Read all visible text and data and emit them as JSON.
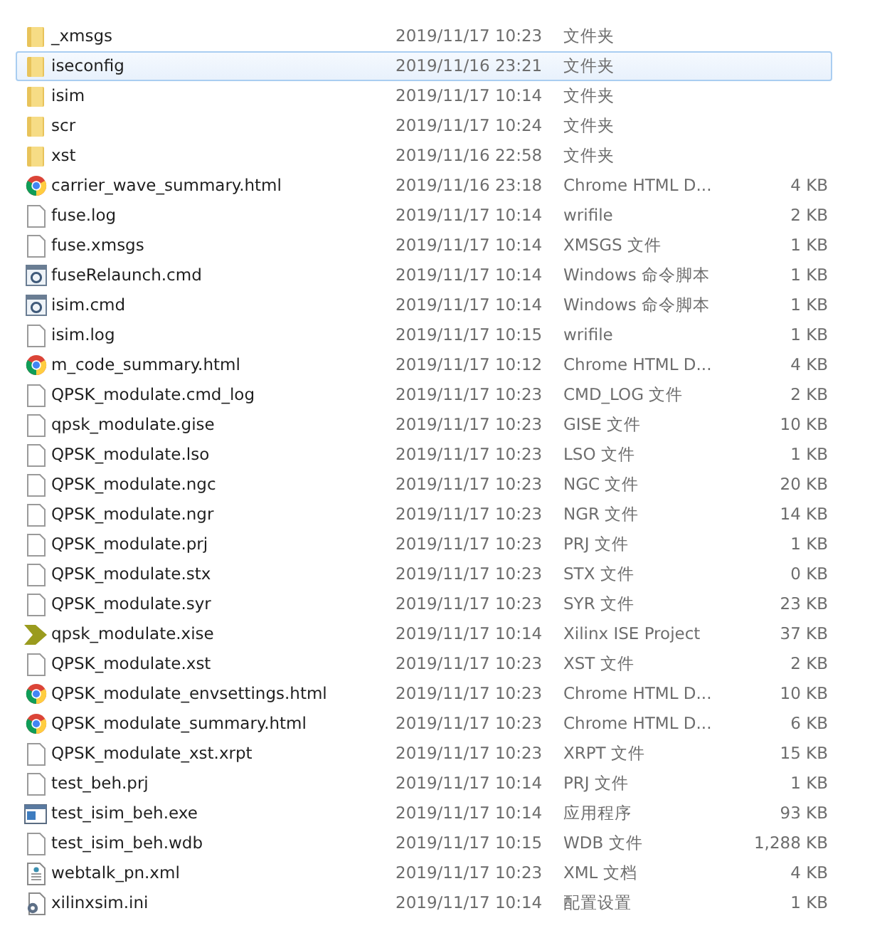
{
  "files": [
    {
      "kind": "folder",
      "name": "_xmsgs",
      "modified": "2019/11/17 10:23",
      "type": "文件夹",
      "selected": false
    },
    {
      "kind": "folder",
      "name": "iseconfig",
      "modified": "2019/11/16 23:21",
      "type": "文件夹",
      "selected": true
    },
    {
      "kind": "folder",
      "name": "isim",
      "modified": "2019/11/17 10:14",
      "type": "文件夹",
      "selected": false
    },
    {
      "kind": "folder",
      "name": "scr",
      "modified": "2019/11/17 10:24",
      "type": "文件夹",
      "selected": false
    },
    {
      "kind": "folder",
      "name": "xst",
      "modified": "2019/11/16 22:58",
      "type": "文件夹",
      "selected": false
    },
    {
      "kind": "chrome",
      "name": "carrier_wave_summary.html",
      "modified": "2019/11/16 23:18",
      "type": "Chrome HTML D...",
      "size": "4 KB",
      "selected": false
    },
    {
      "kind": "file",
      "name": "fuse.log",
      "modified": "2019/11/17 10:14",
      "type": "wrifile",
      "size": "2 KB",
      "selected": false
    },
    {
      "kind": "file",
      "name": "fuse.xmsgs",
      "modified": "2019/11/17 10:14",
      "type": "XMSGS 文件",
      "size": "1 KB",
      "selected": false
    },
    {
      "kind": "cmd",
      "name": "fuseRelaunch.cmd",
      "modified": "2019/11/17 10:14",
      "type": "Windows 命令脚本",
      "size": "1 KB",
      "selected": false
    },
    {
      "kind": "cmd",
      "name": "isim.cmd",
      "modified": "2019/11/17 10:14",
      "type": "Windows 命令脚本",
      "size": "1 KB",
      "selected": false
    },
    {
      "kind": "file",
      "name": "isim.log",
      "modified": "2019/11/17 10:15",
      "type": "wrifile",
      "size": "1 KB",
      "selected": false
    },
    {
      "kind": "chrome",
      "name": "m_code_summary.html",
      "modified": "2019/11/17 10:12",
      "type": "Chrome HTML D...",
      "size": "4 KB",
      "selected": false
    },
    {
      "kind": "file",
      "name": "QPSK_modulate.cmd_log",
      "modified": "2019/11/17 10:23",
      "type": "CMD_LOG 文件",
      "size": "2 KB",
      "selected": false
    },
    {
      "kind": "file",
      "name": "qpsk_modulate.gise",
      "modified": "2019/11/17 10:23",
      "type": "GISE 文件",
      "size": "10 KB",
      "selected": false
    },
    {
      "kind": "file",
      "name": "QPSK_modulate.lso",
      "modified": "2019/11/17 10:23",
      "type": "LSO 文件",
      "size": "1 KB",
      "selected": false
    },
    {
      "kind": "file",
      "name": "QPSK_modulate.ngc",
      "modified": "2019/11/17 10:23",
      "type": "NGC 文件",
      "size": "20 KB",
      "selected": false
    },
    {
      "kind": "file",
      "name": "QPSK_modulate.ngr",
      "modified": "2019/11/17 10:23",
      "type": "NGR 文件",
      "size": "14 KB",
      "selected": false
    },
    {
      "kind": "file",
      "name": "QPSK_modulate.prj",
      "modified": "2019/11/17 10:23",
      "type": "PRJ 文件",
      "size": "1 KB",
      "selected": false
    },
    {
      "kind": "file",
      "name": "QPSK_modulate.stx",
      "modified": "2019/11/17 10:23",
      "type": "STX 文件",
      "size": "0 KB",
      "selected": false
    },
    {
      "kind": "file",
      "name": "QPSK_modulate.syr",
      "modified": "2019/11/17 10:23",
      "type": "SYR 文件",
      "size": "23 KB",
      "selected": false
    },
    {
      "kind": "xise",
      "name": "qpsk_modulate.xise",
      "modified": "2019/11/17 10:14",
      "type": "Xilinx ISE Project",
      "size": "37 KB",
      "selected": false
    },
    {
      "kind": "file",
      "name": "QPSK_modulate.xst",
      "modified": "2019/11/17 10:23",
      "type": "XST 文件",
      "size": "2 KB",
      "selected": false
    },
    {
      "kind": "chrome",
      "name": "QPSK_modulate_envsettings.html",
      "modified": "2019/11/17 10:23",
      "type": "Chrome HTML D...",
      "size": "10 KB",
      "selected": false
    },
    {
      "kind": "chrome",
      "name": "QPSK_modulate_summary.html",
      "modified": "2019/11/17 10:23",
      "type": "Chrome HTML D...",
      "size": "6 KB",
      "selected": false
    },
    {
      "kind": "file",
      "name": "QPSK_modulate_xst.xrpt",
      "modified": "2019/11/17 10:23",
      "type": "XRPT 文件",
      "size": "15 KB",
      "selected": false
    },
    {
      "kind": "file",
      "name": "test_beh.prj",
      "modified": "2019/11/17 10:14",
      "type": "PRJ 文件",
      "size": "1 KB",
      "selected": false
    },
    {
      "kind": "exe",
      "name": "test_isim_beh.exe",
      "modified": "2019/11/17 10:14",
      "type": "应用程序",
      "size": "93 KB",
      "selected": false
    },
    {
      "kind": "file",
      "name": "test_isim_beh.wdb",
      "modified": "2019/11/17 10:15",
      "type": "WDB 文件",
      "size": "1,288 KB",
      "selected": false
    },
    {
      "kind": "xml",
      "name": "webtalk_pn.xml",
      "modified": "2019/11/17 10:23",
      "type": "XML 文档",
      "size": "4 KB",
      "selected": false
    },
    {
      "kind": "ini",
      "name": "xilinxsim.ini",
      "modified": "2019/11/17 10:14",
      "type": "配置设置",
      "size": "1 KB",
      "selected": false
    }
  ]
}
